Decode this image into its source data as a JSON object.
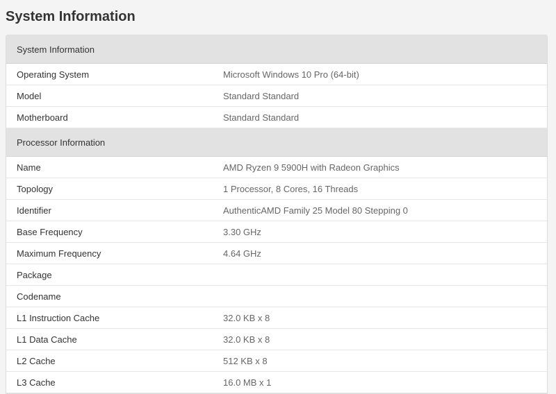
{
  "page": {
    "title": "System Information"
  },
  "sections": [
    {
      "header": "System Information",
      "rows": [
        {
          "label": "Operating System",
          "value": "Microsoft Windows 10 Pro (64-bit)"
        },
        {
          "label": "Model",
          "value": "Standard Standard"
        },
        {
          "label": "Motherboard",
          "value": "Standard Standard"
        }
      ]
    },
    {
      "header": "Processor Information",
      "rows": [
        {
          "label": "Name",
          "value": "AMD Ryzen 9 5900H with Radeon Graphics"
        },
        {
          "label": "Topology",
          "value": "1 Processor, 8 Cores, 16 Threads"
        },
        {
          "label": "Identifier",
          "value": "AuthenticAMD Family 25 Model 80 Stepping 0"
        },
        {
          "label": "Base Frequency",
          "value": "3.30 GHz"
        },
        {
          "label": "Maximum Frequency",
          "value": "4.64 GHz"
        },
        {
          "label": "Package",
          "value": ""
        },
        {
          "label": "Codename",
          "value": ""
        },
        {
          "label": "L1 Instruction Cache",
          "value": "32.0 KB x 8"
        },
        {
          "label": "L1 Data Cache",
          "value": "32.0 KB x 8"
        },
        {
          "label": "L2 Cache",
          "value": "512 KB x 8"
        },
        {
          "label": "L3 Cache",
          "value": "16.0 MB x 1"
        }
      ]
    }
  ],
  "colors": {
    "background": "#f4f4f4",
    "card": "#ffffff",
    "section_header": "#e2e2e2",
    "label_text": "#333333",
    "value_text": "#666666"
  }
}
